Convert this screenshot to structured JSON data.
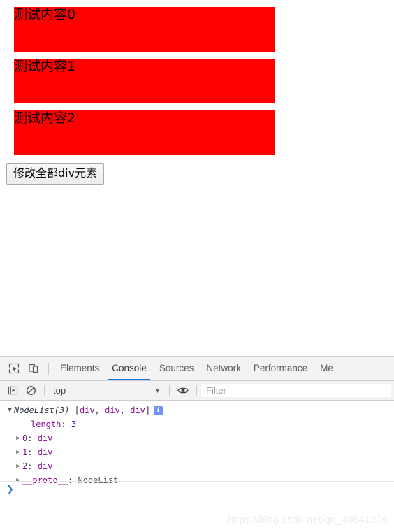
{
  "page": {
    "divs": [
      {
        "text": "测试内容0",
        "bg_color": "#ff0000"
      },
      {
        "text": "测试内容1",
        "bg_color": "#ff0000"
      },
      {
        "text": "测试内容2",
        "bg_color": "#ff0000"
      }
    ],
    "button_label": "修改全部div元素"
  },
  "devtools": {
    "toolbar": {
      "inspect_icon": "inspect-element-icon",
      "device_icon": "device-toolbar-icon"
    },
    "tabs": [
      {
        "label": "Elements",
        "active": false
      },
      {
        "label": "Console",
        "active": true
      },
      {
        "label": "Sources",
        "active": false
      },
      {
        "label": "Network",
        "active": false
      },
      {
        "label": "Performance",
        "active": false
      },
      {
        "label": "Me",
        "active": false
      }
    ],
    "active_tab_color": "#1a73e8",
    "filterbar": {
      "execute_icon": "execution-context-icon",
      "clear_icon": "clear-console-icon",
      "context_value": "top",
      "context_caret": "▼",
      "eye_icon": "live-expression-eye-icon",
      "filter_placeholder": "Filter",
      "filter_value": ""
    },
    "console": {
      "entries": [
        {
          "indent": 0,
          "triangle": "▼",
          "expanded": true,
          "parts": [
            {
              "text": "NodeList(3)",
              "style": "obj"
            },
            {
              "text": " ",
              "style": "plain"
            },
            {
              "text": "[",
              "style": "plain"
            },
            {
              "text": "div",
              "style": "prop"
            },
            {
              "text": ", ",
              "style": "plain"
            },
            {
              "text": "div",
              "style": "prop"
            },
            {
              "text": ", ",
              "style": "plain"
            },
            {
              "text": "div",
              "style": "prop"
            },
            {
              "text": "]",
              "style": "plain"
            }
          ],
          "badge": "i"
        },
        {
          "indent": 2,
          "triangle": "",
          "expanded": false,
          "parts": [
            {
              "text": "length",
              "style": "prop"
            },
            {
              "text": ": ",
              "style": "plain"
            },
            {
              "text": "3",
              "style": "num"
            }
          ],
          "badge": ""
        },
        {
          "indent": 1,
          "triangle": "▶",
          "expanded": false,
          "parts": [
            {
              "text": "0",
              "style": "prop"
            },
            {
              "text": ": ",
              "style": "plain"
            },
            {
              "text": "div",
              "style": "prop"
            }
          ],
          "badge": ""
        },
        {
          "indent": 1,
          "triangle": "▶",
          "expanded": false,
          "parts": [
            {
              "text": "1",
              "style": "prop"
            },
            {
              "text": ": ",
              "style": "plain"
            },
            {
              "text": "div",
              "style": "prop"
            }
          ],
          "badge": ""
        },
        {
          "indent": 1,
          "triangle": "▶",
          "expanded": false,
          "parts": [
            {
              "text": "2",
              "style": "prop"
            },
            {
              "text": ": ",
              "style": "plain"
            },
            {
              "text": "div",
              "style": "prop"
            }
          ],
          "badge": ""
        },
        {
          "indent": 1,
          "triangle": "▶",
          "expanded": false,
          "parts": [
            {
              "text": "__proto__",
              "style": "prop"
            },
            {
              "text": ": ",
              "style": "plain"
            },
            {
              "text": "NodeList",
              "style": "dim"
            }
          ],
          "badge": ""
        }
      ],
      "prompt_caret": "❯"
    }
  },
  "watermark": "https://blog.csdn.net/qq_40641206"
}
